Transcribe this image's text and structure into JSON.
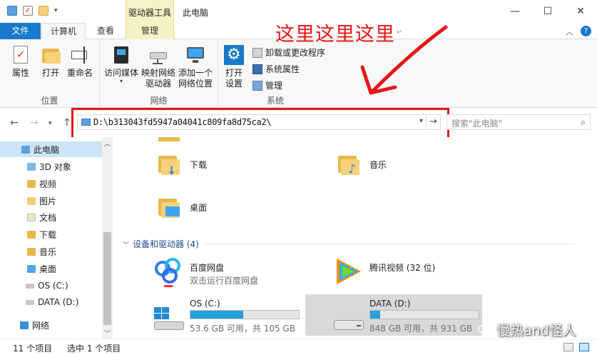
{
  "window": {
    "title": "此电脑",
    "context_tab": "驱动器工具",
    "buttons": {
      "minimize": "—",
      "maximize": "☐",
      "close": "✕"
    }
  },
  "tabs": [
    {
      "label": "文件"
    },
    {
      "label": "计算机"
    },
    {
      "label": "查看"
    },
    {
      "label": "管理"
    }
  ],
  "ribbon": {
    "groups": {
      "location": "位置",
      "network": "网络",
      "system": "系统"
    },
    "properties": "属性",
    "open": "打开",
    "rename": "重命名",
    "access_media": "访问媒体",
    "map_drive_line1": "映射网络",
    "map_drive_line2": "驱动器",
    "add_location_line1": "添加一个",
    "add_location_line2": "网络位置",
    "open_settings_line1": "打开",
    "open_settings_line2": "设置",
    "uninstall": "卸载或更改程序",
    "system_props": "系统属性",
    "manage": "管理"
  },
  "annotation": {
    "text": "这里这里这里",
    "mark": "↵"
  },
  "address": {
    "path": "D:\\b313043fd5947a04041c809fa8d75ca2\\"
  },
  "search": {
    "placeholder": "搜索\"此电脑\""
  },
  "nav": {
    "items": [
      "此电脑",
      "3D 对象",
      "视频",
      "图片",
      "文档",
      "下载",
      "音乐",
      "桌面",
      "OS (C:)",
      "DATA (D:)",
      "网络"
    ]
  },
  "content": {
    "folders": [
      {
        "name": "下载"
      },
      {
        "name": "音乐"
      },
      {
        "name": "桌面"
      }
    ],
    "section": "设备和驱动器 (4)",
    "devices": [
      {
        "name": "百度网盘",
        "sub": "双击运行百度网盘"
      },
      {
        "name": "腾讯视频 (32 位)"
      },
      {
        "name": "OS (C:)",
        "sub": "53.6 GB 可用，共 105 GB",
        "used_pct": 49
      },
      {
        "name": "DATA (D:)",
        "sub": "848 GB 可用，共 931 GB",
        "used_pct": 9
      }
    ]
  },
  "status": {
    "items_count": "11 个项目",
    "selected": "选中 1 个项目"
  },
  "watermark": {
    "text": "慢热and怪人"
  },
  "colors": {
    "accent": "#1979ca",
    "annotation_red": "#e61616",
    "progress": "#26a0da"
  }
}
